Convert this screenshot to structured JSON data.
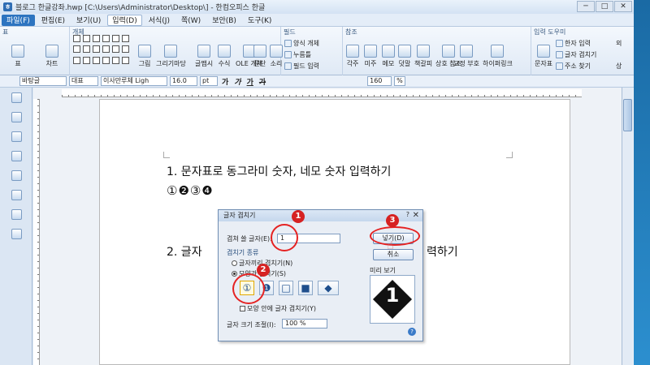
{
  "window": {
    "title": "블로그 한글강좌.hwp [C:\\Users\\Administrator\\Desktop\\] - 한컴오피스 한글",
    "buttons": [
      "─",
      "□",
      "✕"
    ]
  },
  "menubar": {
    "items": [
      "파일(F)",
      "편집(E)",
      "보기(U)",
      "입력(D)",
      "서식(J)",
      "쪽(W)",
      "보안(B)",
      "도구(K)"
    ],
    "file_index": 0,
    "active_index": 3
  },
  "ribbon": {
    "groups": [
      "표",
      "개체",
      "필드",
      "참조",
      "입력 도우미"
    ],
    "table_btn": "표",
    "chart_btn": "차트",
    "picture_btn": "그림",
    "drawing_btn": "그리기마당",
    "glyph_btn": "글맵시",
    "formula_btn": "수식",
    "ole_btn": "OLE\n개체",
    "paragraph_btn": "문단",
    "sound_btn": "소리",
    "form_btn": "양식 개체",
    "button_btn": "누름틀",
    "field_btn": "필드 입력",
    "footnote_btn": "각주",
    "endnote_btn": "미주",
    "memo_btn": "메모",
    "comment_btn": "덧말",
    "bookmark_btn": "책갈피",
    "crossref_btn": "상호\n참조",
    "hyperlink_btn": "교정\n부호",
    "hyperlink2_btn": "하이퍼링크",
    "charmap_btn": "문자표",
    "hanja_btn": "한자 입력",
    "overlap_btn": "글자 겹치기",
    "address_btn": "주소 찾기",
    "extra1": "외",
    "extra2": "상"
  },
  "toolbar2": {
    "style": "바탕글",
    "lang": "대표",
    "font": "이사만루체 Ligh",
    "size": "16.0",
    "unit": "pt",
    "zoom": "160",
    "zoom_unit": "%",
    "bold": "가",
    "italic": "가",
    "underline": "가",
    "strike": "가"
  },
  "document": {
    "line1": "1. 문자표로 동그라미 숫자, 네모 숫자 입력하기",
    "line2": "①❷③❹",
    "line3_start": "2. 글자",
    "line3_end": "력하기"
  },
  "dialog": {
    "title": "글자 겹치기",
    "chars_label": "겹쳐 쓸 글자(E):",
    "chars_value": "1",
    "type_label": "겹치기 종류",
    "opt1": "글자끼리 겹치기(N)",
    "opt2": "모양과 겹치기(S)",
    "shapes": [
      "①",
      "❶",
      "□",
      "■",
      "◆"
    ],
    "inner_checkbox": "모양 안에 글자 겹치기(Y)",
    "size_label": "글자 크기 조절(I):",
    "size_value": "100 %",
    "ok_label": "넣기(D)",
    "cancel_label": "취소",
    "preview_label": "미리 보기",
    "preview_char": "1"
  },
  "annotations": {
    "badge1": "1",
    "badge2": "2",
    "badge3": "3",
    "color": "#e52222"
  }
}
